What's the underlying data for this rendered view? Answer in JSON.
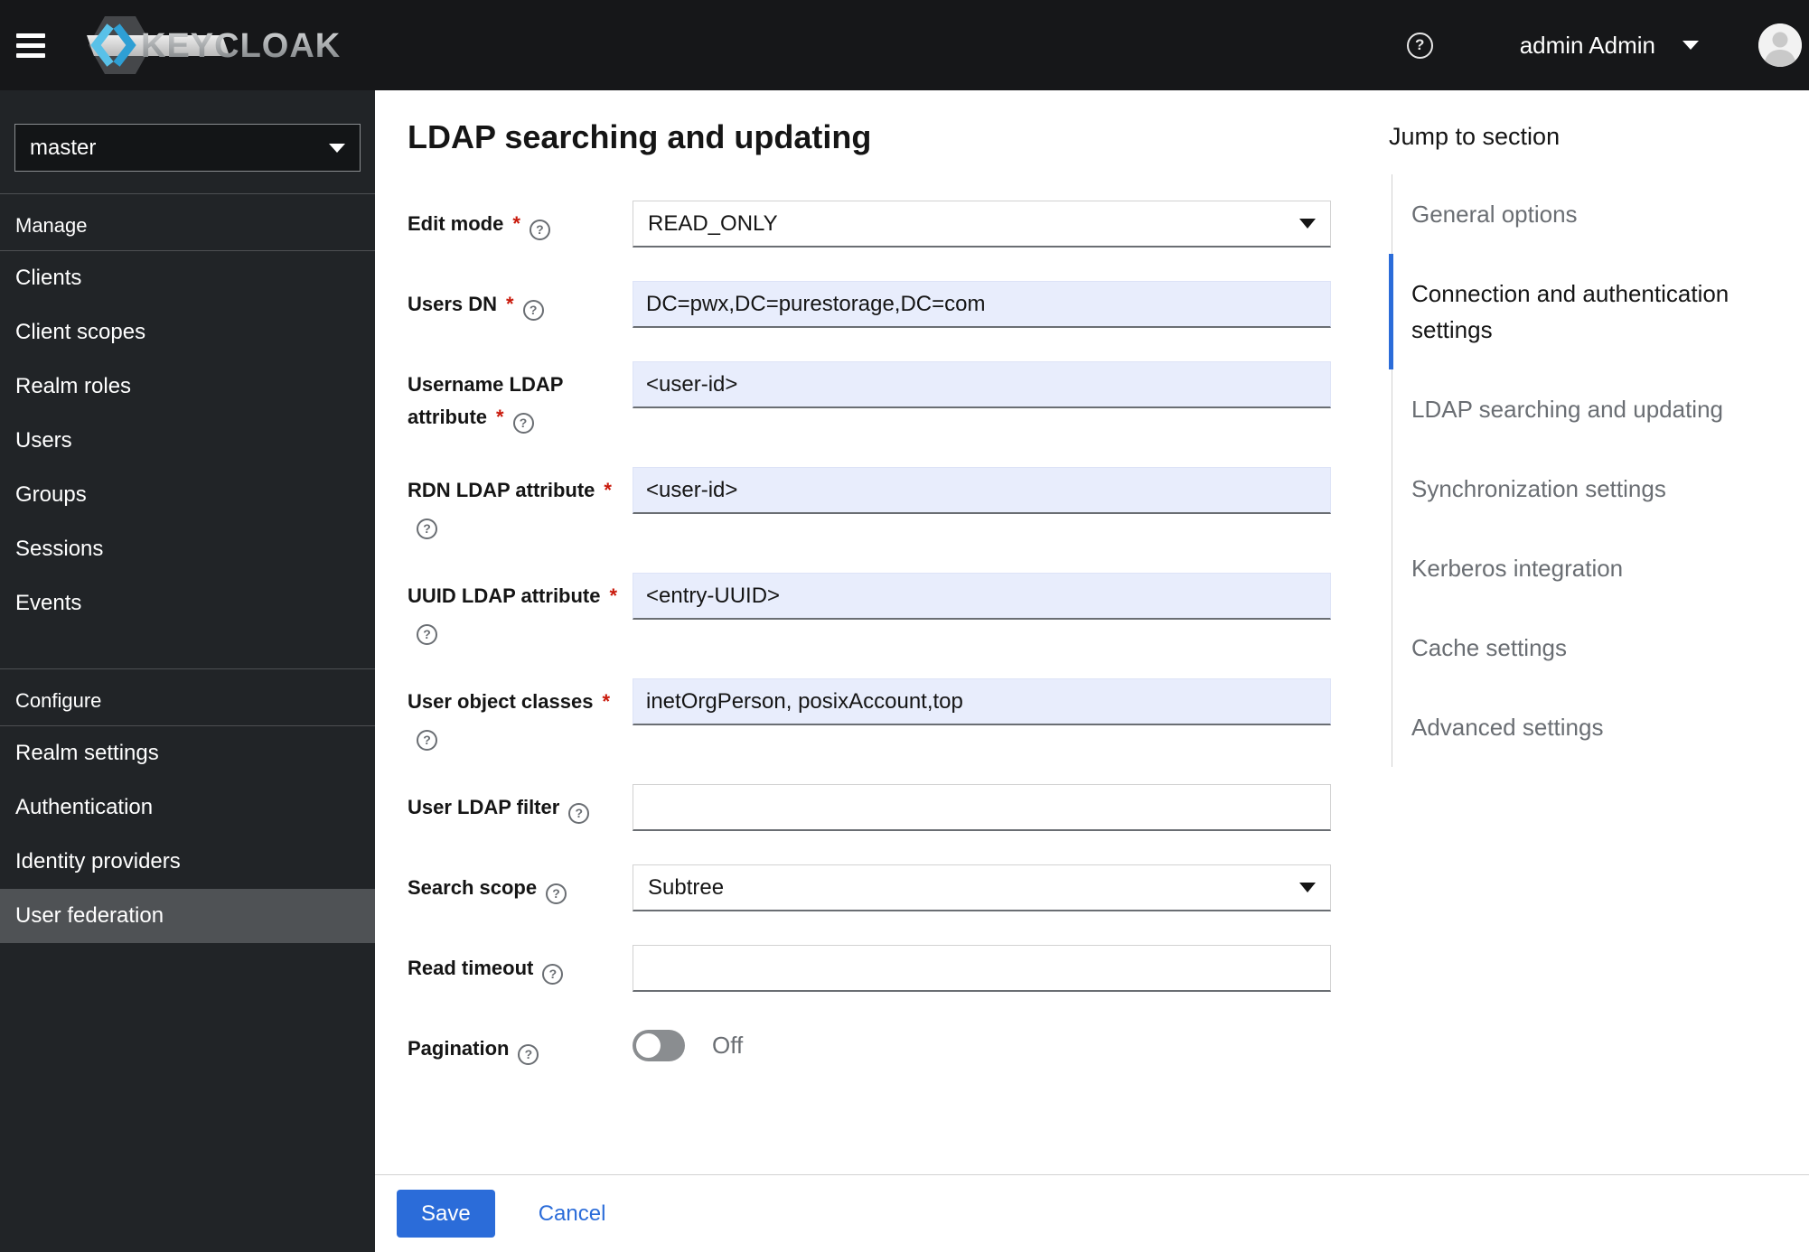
{
  "header": {
    "brand_text": "KEYCLOAK",
    "user_name": "admin Admin"
  },
  "sidebar": {
    "realm": "master",
    "groups": [
      {
        "heading": "Manage",
        "items": [
          {
            "label": "Clients",
            "active": false
          },
          {
            "label": "Client scopes",
            "active": false
          },
          {
            "label": "Realm roles",
            "active": false
          },
          {
            "label": "Users",
            "active": false
          },
          {
            "label": "Groups",
            "active": false
          },
          {
            "label": "Sessions",
            "active": false
          },
          {
            "label": "Events",
            "active": false
          }
        ]
      },
      {
        "heading": "Configure",
        "items": [
          {
            "label": "Realm settings",
            "active": false
          },
          {
            "label": "Authentication",
            "active": false
          },
          {
            "label": "Identity providers",
            "active": false
          },
          {
            "label": "User federation",
            "active": true
          }
        ]
      }
    ]
  },
  "main": {
    "title": "LDAP searching and updating",
    "form": {
      "fields": [
        {
          "label": "Edit mode",
          "required": true,
          "help": true,
          "control": "select",
          "value": "READ_ONLY"
        },
        {
          "label": "Users DN",
          "required": true,
          "help": true,
          "control": "text",
          "value": "DC=pwx,DC=purestorage,DC=com",
          "filled": true
        },
        {
          "label": "Username LDAP attribute",
          "required": true,
          "help": true,
          "control": "text",
          "value": "<user-id>",
          "filled": true
        },
        {
          "label": "RDN LDAP attribute",
          "required": true,
          "help": true,
          "control": "text",
          "value": "<user-id>",
          "filled": true
        },
        {
          "label": "UUID LDAP attribute",
          "required": true,
          "help": true,
          "control": "text",
          "value": "<entry-UUID>",
          "filled": true
        },
        {
          "label": "User object classes",
          "required": true,
          "help": true,
          "control": "text",
          "value": "inetOrgPerson, posixAccount,top",
          "filled": true
        },
        {
          "label": "User LDAP filter",
          "required": false,
          "help": true,
          "control": "text",
          "value": "",
          "filled": false
        },
        {
          "label": "Search scope",
          "required": false,
          "help": true,
          "control": "select",
          "value": "Subtree"
        },
        {
          "label": "Read timeout",
          "required": false,
          "help": true,
          "control": "text",
          "value": "",
          "filled": false
        },
        {
          "label": "Pagination",
          "required": false,
          "help": true,
          "control": "toggle",
          "value": "Off",
          "state": "off"
        }
      ]
    },
    "footer": {
      "save_label": "Save",
      "cancel_label": "Cancel"
    }
  },
  "jump_nav": {
    "title": "Jump to section",
    "items": [
      {
        "label": "General options",
        "active": false
      },
      {
        "label": "Connection and authentication settings",
        "active": true
      },
      {
        "label": "LDAP searching and updating",
        "active": false
      },
      {
        "label": "Synchronization settings",
        "active": false
      },
      {
        "label": "Kerberos integration",
        "active": false
      },
      {
        "label": "Cache settings",
        "active": false
      },
      {
        "label": "Advanced settings",
        "active": false
      }
    ]
  },
  "colors": {
    "accent_blue": "#2b6cd9",
    "filled_input_bg": "#e8edfc",
    "danger_red": "#c9190b",
    "header_bg": "#161719",
    "sidebar_bg": "#212427",
    "sidebar_active_bg": "#4f5255"
  }
}
